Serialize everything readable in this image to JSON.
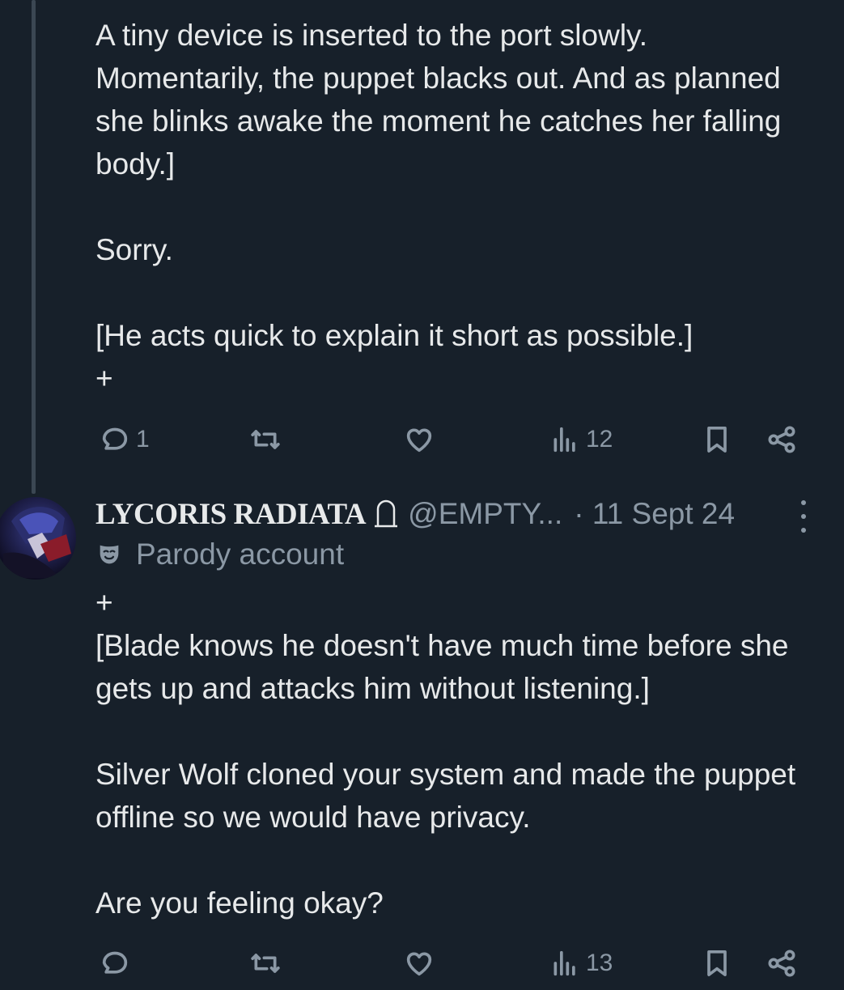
{
  "tweet1": {
    "text": "A tiny device is inserted to the port slowly. Momentarily, the puppet blacks out. And as planned she blinks awake the moment he catches her falling body.]\n\nSorry.\n\n[He acts quick to explain it short as possible.]\n+",
    "reply_count": "1",
    "view_count": "12"
  },
  "tweet2": {
    "display_name": "LYCORIS RADIATA",
    "handle": "@EMPTY...",
    "date": "· 11 Sept 24",
    "label": "Parody account",
    "text": "+\n[Blade knows he doesn't have much time before she gets up and attacks him without listening.]\n\nSilver Wolf cloned your system and made the puppet offline so we would have privacy.\n\nAre you feeling okay?",
    "reply_count": "",
    "view_count": "13"
  },
  "colors": {
    "background": "#17202a",
    "text": "#e7e9ea",
    "muted": "#8b98a5",
    "thread_line": "#3b4753"
  },
  "icons": [
    "reply-icon",
    "retweet-icon",
    "like-icon",
    "views-icon",
    "bookmark-icon",
    "share-icon",
    "tombstone-icon",
    "parody-mask-icon",
    "more-icon"
  ]
}
